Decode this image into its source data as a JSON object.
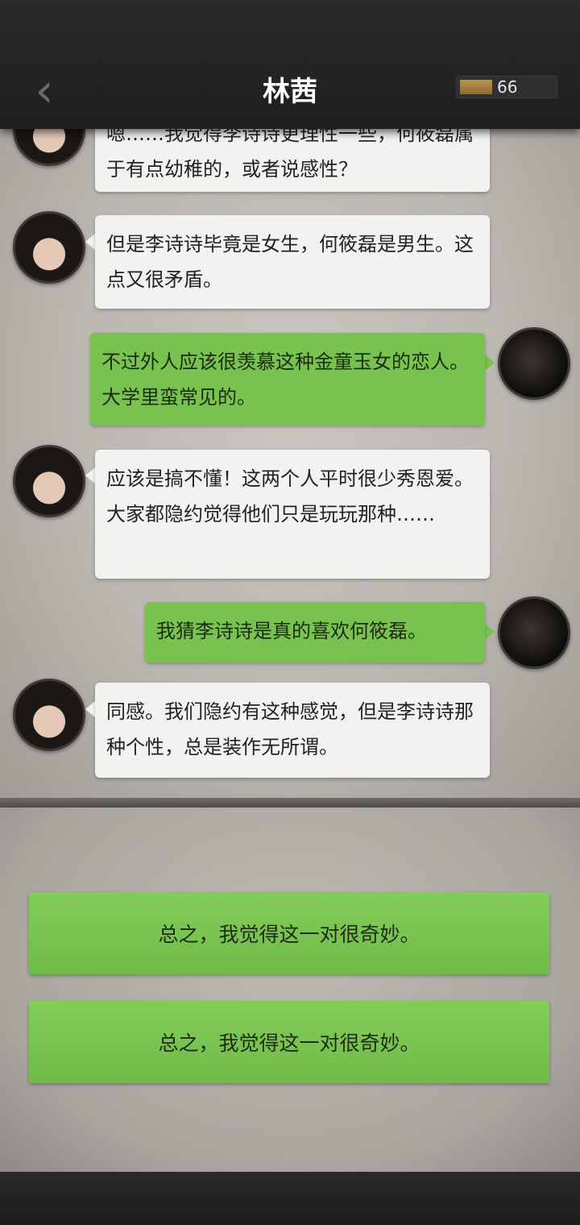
{
  "header": {
    "back_icon": "chevron-left-icon",
    "title": "林茜",
    "counter_value": "66",
    "counter_fill": 0.35
  },
  "messages": [
    {
      "side": "left",
      "text": "嗯……我觉得李诗诗更理性一些，何筱磊属于有点幼稚的，或者说感性？"
    },
    {
      "side": "left",
      "text": "但是李诗诗毕竟是女生，何筱磊是男生。这点又很矛盾。"
    },
    {
      "side": "right",
      "text": "不过外人应该很羡慕这种金童玉女的恋人。大学里蛮常见的。"
    },
    {
      "side": "left",
      "text": "应该是搞不懂！这两个人平时很少秀恩爱。大家都隐约觉得他们只是玩玩那种……"
    },
    {
      "side": "right",
      "text": "我猜李诗诗是真的喜欢何筱磊。"
    },
    {
      "side": "left",
      "text": "同感。我们隐约有这种感觉，但是李诗诗那种个性，总是装作无所谓。"
    }
  ],
  "choices": [
    {
      "label": "总之，我觉得这一对很奇妙。"
    },
    {
      "label": "总之，我觉得这一对很奇妙。"
    }
  ],
  "colors": {
    "left_bubble": "#f2f2f0",
    "right_bubble": "#78c34f",
    "choice_button": "#78c34f"
  }
}
